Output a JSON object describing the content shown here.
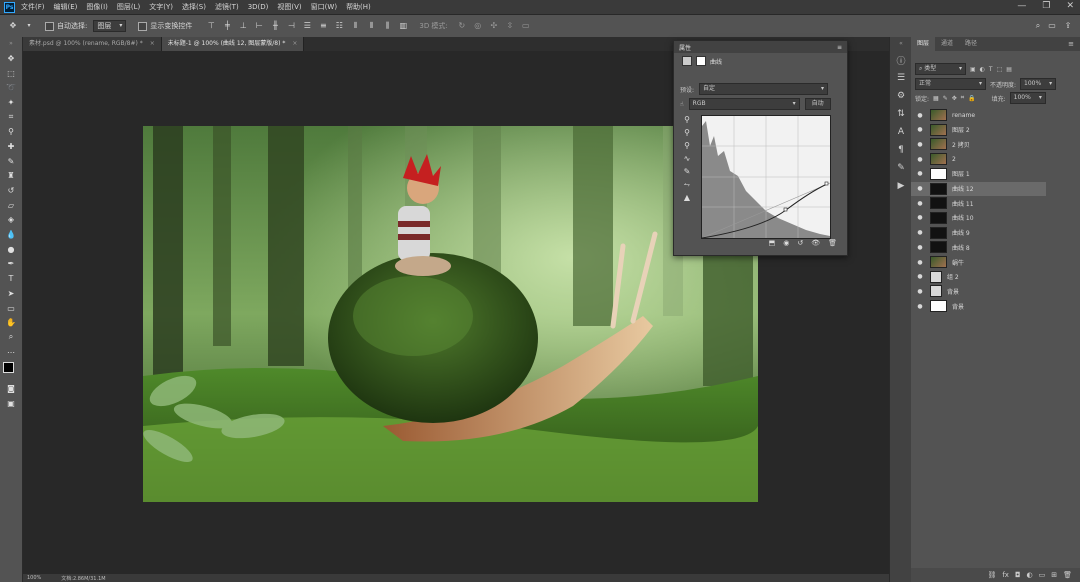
{
  "menubar": {
    "logo": "Ps",
    "items": [
      "文件(F)",
      "编辑(E)",
      "图像(I)",
      "图层(L)",
      "文字(Y)",
      "选择(S)",
      "滤镜(T)",
      "3D(D)",
      "视图(V)",
      "窗口(W)",
      "帮助(H)"
    ],
    "controls": [
      "—",
      "❐",
      "✕"
    ]
  },
  "options": {
    "auto_select_label": "自动选择:",
    "auto_select_value": "图层",
    "show_transform_label": "显示变换控件",
    "mode_3d_label": "3D 模式:"
  },
  "tabs": [
    {
      "label": "素材.psd @ 100% (rename, RGB/8#) *",
      "active": false
    },
    {
      "label": "未标题-1 @ 100% (曲线 12, 图层蒙版/8) *",
      "active": true
    }
  ],
  "status": {
    "zoom": "100%",
    "doc": "文档:2.86M/31.1M"
  },
  "layers_panel": {
    "tabs": [
      "图层",
      "通道",
      "路径"
    ],
    "filter_label": "类型",
    "blend_mode": "正常",
    "opacity_label": "不透明度:",
    "opacity_value": "100%",
    "lock_label": "锁定:",
    "fill_label": "填充:",
    "fill_value": "100%",
    "layers": [
      {
        "name": "rename",
        "thumb": "photo"
      },
      {
        "name": "图层 2",
        "thumb": "photo"
      },
      {
        "name": "2 拷贝",
        "thumb": "photo"
      },
      {
        "name": "2",
        "thumb": "photo"
      },
      {
        "name": "图层 1",
        "thumb": "white"
      },
      {
        "name": "曲线 12",
        "thumb": "dark"
      },
      {
        "name": "曲线 11",
        "thumb": "dark"
      },
      {
        "name": "曲线 10",
        "thumb": "dark"
      },
      {
        "name": "曲线 9",
        "thumb": "dark"
      },
      {
        "name": "曲线 8",
        "thumb": "dark"
      },
      {
        "name": "蜗牛",
        "thumb": "photo"
      },
      {
        "name": "组 2",
        "thumb": "folder"
      },
      {
        "name": "背景",
        "thumb": "folder"
      },
      {
        "name": "背景",
        "thumb": "white"
      }
    ],
    "footer_icons": [
      "链接",
      "fx",
      "蒙版",
      "调整",
      "组",
      "新建",
      "删除"
    ]
  },
  "properties": {
    "title": "属性",
    "subtitle": "曲线",
    "preset_label": "预设:",
    "preset_value": "自定",
    "channel_value": "RGB",
    "auto_button": "自动"
  },
  "colors": {
    "accent": "#31a8ff",
    "panel": "#535353",
    "dark": "#282828"
  }
}
